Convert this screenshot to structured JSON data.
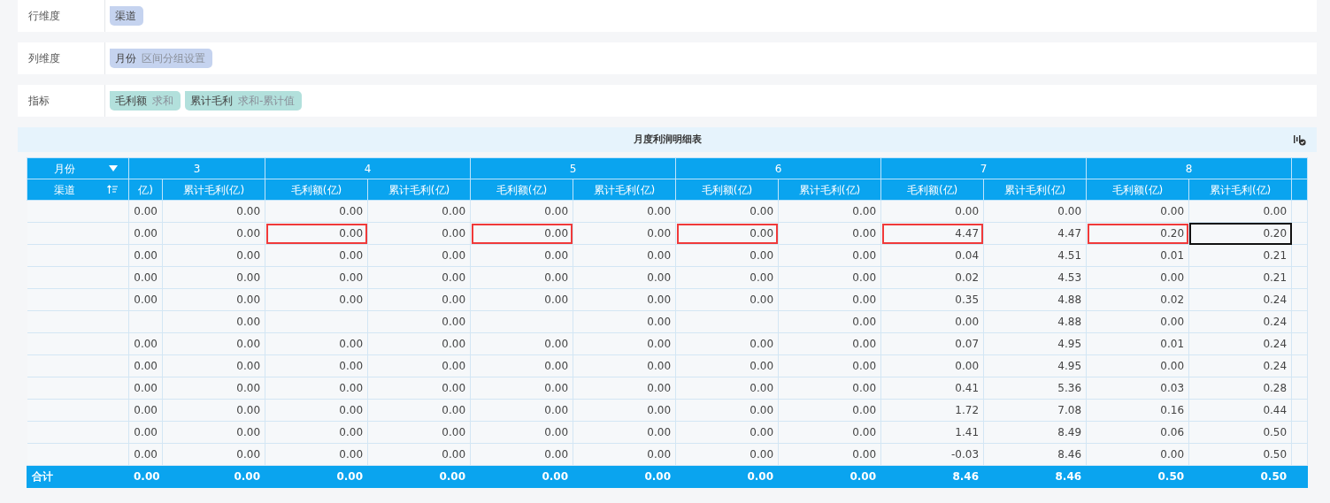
{
  "config": [
    {
      "label": "行维度",
      "chips": [
        {
          "kind": "dimension",
          "name": "渠道"
        }
      ]
    },
    {
      "label": "列维度",
      "chips": [
        {
          "kind": "dimension",
          "name": "月份",
          "note": "区间分组设置"
        }
      ]
    },
    {
      "label": "指标",
      "chips": [
        {
          "kind": "measure",
          "name": "毛利额",
          "note": "求和"
        },
        {
          "kind": "measure",
          "name": "累计毛利",
          "note": "求和-累计值"
        }
      ]
    }
  ],
  "table": {
    "title": "月度利润明细表",
    "corner": {
      "column_dim": "月份",
      "row_dim": "渠道"
    },
    "months": [
      "3",
      "4",
      "5",
      "6",
      "7",
      "8"
    ],
    "columns": [
      "亿)",
      "累计毛利(亿)",
      "毛利额(亿)",
      "累计毛利(亿)",
      "毛利额(亿)",
      "累计毛利(亿)",
      "毛利额(亿)",
      "累计毛利(亿)",
      "毛利额(亿)",
      "累计毛利(亿)",
      "毛利额(亿)",
      "累计毛利(亿)"
    ],
    "rows": [
      {
        "cells": [
          "0.00",
          "0.00",
          "0.00",
          "0.00",
          "0.00",
          "0.00",
          "0.00",
          "0.00",
          "0.00",
          "0.00",
          "0.00",
          "0.00"
        ],
        "flagged": [
          false,
          false,
          false,
          false,
          false,
          false,
          false,
          false,
          false,
          false,
          false,
          false
        ],
        "selected": [
          false,
          false,
          false,
          false,
          false,
          false,
          false,
          false,
          false,
          false,
          false,
          false
        ]
      },
      {
        "cells": [
          "0.00",
          "0.00",
          "0.00",
          "0.00",
          "0.00",
          "0.00",
          "0.00",
          "0.00",
          "4.47",
          "4.47",
          "0.20",
          "0.20"
        ],
        "flagged": [
          false,
          false,
          true,
          false,
          true,
          false,
          true,
          false,
          true,
          false,
          true,
          false
        ],
        "selected": [
          false,
          false,
          false,
          false,
          false,
          false,
          false,
          false,
          false,
          false,
          false,
          true
        ]
      },
      {
        "cells": [
          "0.00",
          "0.00",
          "0.00",
          "0.00",
          "0.00",
          "0.00",
          "0.00",
          "0.00",
          "0.04",
          "4.51",
          "0.01",
          "0.21"
        ],
        "flagged": [
          false,
          false,
          false,
          false,
          false,
          false,
          false,
          false,
          false,
          false,
          false,
          false
        ],
        "selected": [
          false,
          false,
          false,
          false,
          false,
          false,
          false,
          false,
          false,
          false,
          false,
          false
        ]
      },
      {
        "cells": [
          "0.00",
          "0.00",
          "0.00",
          "0.00",
          "0.00",
          "0.00",
          "0.00",
          "0.00",
          "0.02",
          "4.53",
          "0.00",
          "0.21"
        ],
        "flagged": [
          false,
          false,
          false,
          false,
          false,
          false,
          false,
          false,
          false,
          false,
          false,
          false
        ],
        "selected": [
          false,
          false,
          false,
          false,
          false,
          false,
          false,
          false,
          false,
          false,
          false,
          false
        ]
      },
      {
        "cells": [
          "0.00",
          "0.00",
          "0.00",
          "0.00",
          "0.00",
          "0.00",
          "0.00",
          "0.00",
          "0.35",
          "4.88",
          "0.02",
          "0.24"
        ],
        "flagged": [
          false,
          false,
          false,
          false,
          false,
          false,
          false,
          false,
          false,
          false,
          false,
          false
        ],
        "selected": [
          false,
          false,
          false,
          false,
          false,
          false,
          false,
          false,
          false,
          false,
          false,
          false
        ]
      },
      {
        "cells": [
          "",
          "0.00",
          "",
          "0.00",
          "",
          "0.00",
          "",
          "0.00",
          "0.00",
          "4.88",
          "0.00",
          "0.24"
        ],
        "flagged": [
          false,
          false,
          false,
          false,
          false,
          false,
          false,
          false,
          false,
          false,
          false,
          false
        ],
        "selected": [
          false,
          false,
          false,
          false,
          false,
          false,
          false,
          false,
          false,
          false,
          false,
          false
        ]
      },
      {
        "cells": [
          "0.00",
          "0.00",
          "0.00",
          "0.00",
          "0.00",
          "0.00",
          "0.00",
          "0.00",
          "0.07",
          "4.95",
          "0.01",
          "0.24"
        ],
        "flagged": [
          false,
          false,
          false,
          false,
          false,
          false,
          false,
          false,
          false,
          false,
          false,
          false
        ],
        "selected": [
          false,
          false,
          false,
          false,
          false,
          false,
          false,
          false,
          false,
          false,
          false,
          false
        ]
      },
      {
        "cells": [
          "0.00",
          "0.00",
          "0.00",
          "0.00",
          "0.00",
          "0.00",
          "0.00",
          "0.00",
          "0.00",
          "4.95",
          "0.00",
          "0.24"
        ],
        "flagged": [
          false,
          false,
          false,
          false,
          false,
          false,
          false,
          false,
          false,
          false,
          false,
          false
        ],
        "selected": [
          false,
          false,
          false,
          false,
          false,
          false,
          false,
          false,
          false,
          false,
          false,
          false
        ]
      },
      {
        "cells": [
          "0.00",
          "0.00",
          "0.00",
          "0.00",
          "0.00",
          "0.00",
          "0.00",
          "0.00",
          "0.41",
          "5.36",
          "0.03",
          "0.28"
        ],
        "flagged": [
          false,
          false,
          false,
          false,
          false,
          false,
          false,
          false,
          false,
          false,
          false,
          false
        ],
        "selected": [
          false,
          false,
          false,
          false,
          false,
          false,
          false,
          false,
          false,
          false,
          false,
          false
        ]
      },
      {
        "cells": [
          "0.00",
          "0.00",
          "0.00",
          "0.00",
          "0.00",
          "0.00",
          "0.00",
          "0.00",
          "1.72",
          "7.08",
          "0.16",
          "0.44"
        ],
        "flagged": [
          false,
          false,
          false,
          false,
          false,
          false,
          false,
          false,
          false,
          false,
          false,
          false
        ],
        "selected": [
          false,
          false,
          false,
          false,
          false,
          false,
          false,
          false,
          false,
          false,
          false,
          false
        ]
      },
      {
        "cells": [
          "0.00",
          "0.00",
          "0.00",
          "0.00",
          "0.00",
          "0.00",
          "0.00",
          "0.00",
          "1.41",
          "8.49",
          "0.06",
          "0.50"
        ],
        "flagged": [
          false,
          false,
          false,
          false,
          false,
          false,
          false,
          false,
          false,
          false,
          false,
          false
        ],
        "selected": [
          false,
          false,
          false,
          false,
          false,
          false,
          false,
          false,
          false,
          false,
          false,
          false
        ]
      },
      {
        "cells": [
          "0.00",
          "0.00",
          "0.00",
          "0.00",
          "0.00",
          "0.00",
          "0.00",
          "0.00",
          "-0.03",
          "8.46",
          "0.00",
          "0.50"
        ],
        "flagged": [
          false,
          false,
          false,
          false,
          false,
          false,
          false,
          false,
          false,
          false,
          false,
          false
        ],
        "selected": [
          false,
          false,
          false,
          false,
          false,
          false,
          false,
          false,
          false,
          false,
          false,
          false
        ]
      }
    ],
    "total": {
      "label": "合计",
      "cells": [
        "0.00",
        "0.00",
        "0.00",
        "0.00",
        "0.00",
        "0.00",
        "0.00",
        "0.00",
        "8.46",
        "8.46",
        "0.50",
        "0.50"
      ]
    }
  }
}
